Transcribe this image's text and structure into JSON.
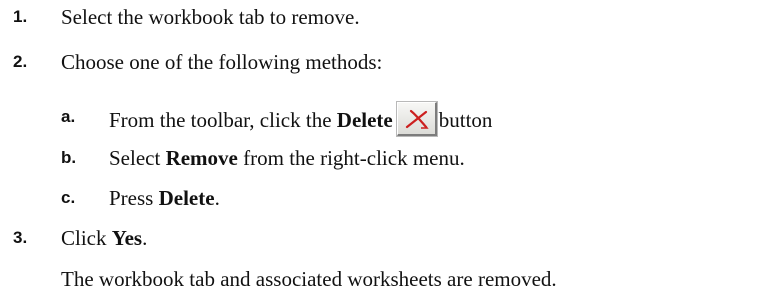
{
  "steps": [
    {
      "num": "1.",
      "text": "Select the workbook tab to remove."
    },
    {
      "num": "2.",
      "text": "Choose one of the following methods:"
    }
  ],
  "substeps": {
    "a": {
      "letter": "a.",
      "pre": "From the toolbar, click the ",
      "bold": "Delete",
      "post": "button",
      "icon": "delete-x-icon",
      "icon_color": "#cc1f1f"
    },
    "b": {
      "letter": "b.",
      "pre": "Select ",
      "bold": "Remove",
      "post": " from the right-click menu."
    },
    "c": {
      "letter": "c.",
      "pre": "Press ",
      "bold": "Delete",
      "post": "."
    }
  },
  "step3": {
    "num": "3.",
    "pre": "Click ",
    "bold": "Yes",
    "post": "."
  },
  "result_text": "The workbook tab and associated worksheets are removed."
}
